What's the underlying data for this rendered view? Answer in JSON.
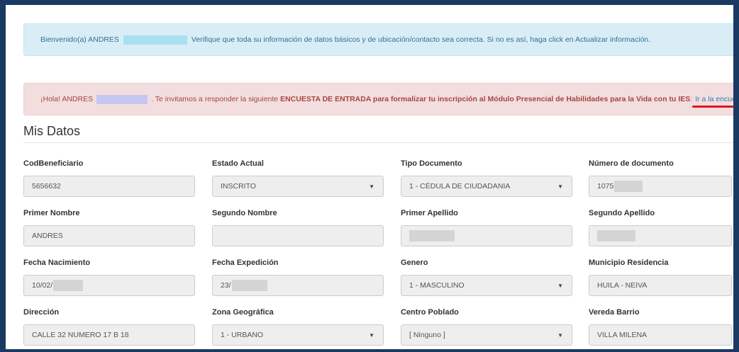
{
  "welcome": {
    "prefix": "Bienvenido(a) ANDRES",
    "text": "Verifique que toda su información de datos básicos y de ubicación/contacto sea correcta. Si no es así, haga click en Actualizar información."
  },
  "survey_alert": {
    "prefix": "¡Hola! ANDRES",
    "text_before": ". Te invitamos a responder la siguiente",
    "strong": "ENCUESTA DE ENTRADA para formalizar tu inscripción al Módulo Presencial de Habilidades para la Vida con tu IES",
    "colon": ":",
    "link": "Ir a la encuesta",
    "accent_color": "#e0161f"
  },
  "section_title": "Mis Datos",
  "fields": {
    "cod_beneficiario": {
      "label": "CodBeneficiario",
      "value": "5656632"
    },
    "estado_actual": {
      "label": "Estado Actual",
      "value": "INSCRITO"
    },
    "tipo_documento": {
      "label": "Tipo Documento",
      "value": "1 - CÉDULA DE CIUDADANIA"
    },
    "numero_documento": {
      "label": "Número de documento",
      "value": "1075"
    },
    "primer_nombre": {
      "label": "Primer Nombre",
      "value": "ANDRES"
    },
    "segundo_nombre": {
      "label": "Segundo Nombre",
      "value": ""
    },
    "primer_apellido": {
      "label": "Primer Apellido",
      "value": ""
    },
    "segundo_apellido": {
      "label": "Segundo Apellido",
      "value": ""
    },
    "fecha_nacimiento": {
      "label": "Fecha Nacimiento",
      "value": "10/02/"
    },
    "fecha_expedicion": {
      "label": "Fecha Expedición",
      "value": "23/"
    },
    "genero": {
      "label": "Genero",
      "value": "1 - MASCULINO"
    },
    "municipio_residencia": {
      "label": "Municipio Residencia",
      "value": "HUILA - NEIVA"
    },
    "direccion": {
      "label": "Dirección",
      "value": "CALLE 32 NUMERO 17 B 18"
    },
    "zona_geografica": {
      "label": "Zona Geográfica",
      "value": "1 - URBANO"
    },
    "centro_poblado": {
      "label": "Centro Poblado",
      "value": "[ Ninguno ]"
    },
    "vereda_barrio": {
      "label": "Vereda Barrio",
      "value": "VILLA MILENA"
    }
  },
  "icons": {
    "select_caret": "caret-down-icon"
  },
  "colors": {
    "frame_border": "#1a3a63",
    "info_bg": "#d9edf7",
    "danger_bg": "#f2dede",
    "link": "#337ab7"
  }
}
